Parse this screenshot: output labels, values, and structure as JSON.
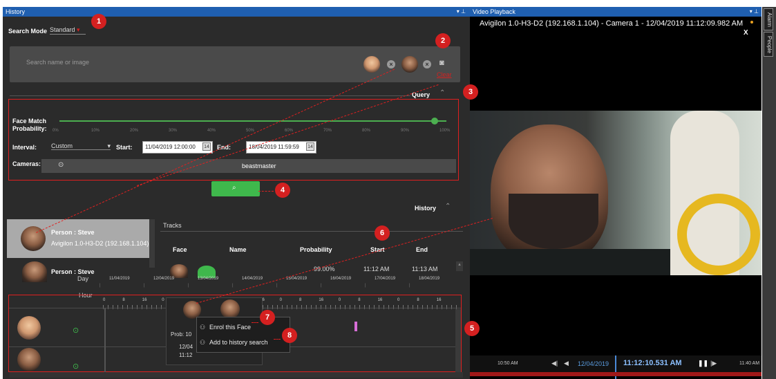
{
  "history_pane": {
    "title": "History",
    "search_mode_label": "Search Mode",
    "search_mode_value": "Standard",
    "search_placeholder": "Search name or image",
    "clear_label": "Clear",
    "query_header": "Query",
    "face_match_label": "Face Match Probability:",
    "probability_ticks": [
      "0%",
      "10%",
      "20%",
      "30%",
      "40%",
      "50%",
      "60%",
      "70%",
      "80%",
      "90%",
      "100%"
    ],
    "probability_value_fraction": 0.97,
    "interval_label": "Interval:",
    "interval_value": "Custom",
    "start_label": "Start:",
    "start_value": "11/04/2019 12:00:00",
    "end_label": "End:",
    "end_value": "18/04/2019 11:59:59",
    "cameras_label": "Cameras:",
    "camera_value": "beastmaster",
    "history_header": "History",
    "tracks_header": "Tracks",
    "results": [
      {
        "person": "Person : Steve",
        "camera": "Avigilon 1.0-H3-D2 (192.168.1.104) -"
      },
      {
        "person": "Person : Steve"
      }
    ],
    "table_headers": [
      "Face",
      "Name",
      "Probability",
      "Start",
      "End"
    ],
    "table_row": {
      "probability": "99.00%",
      "start": "11:12 AM",
      "end": "11:13 AM"
    },
    "timeline": {
      "day_label": "Day",
      "hour_label": "Hour",
      "days": [
        "11/04/2019",
        "12/04/2019",
        "13/04/2019",
        "14/04/2019",
        "15/04/2019",
        "16/04/2019",
        "17/04/2019",
        "18/04/2019"
      ],
      "hours": [
        "0",
        "8",
        "16",
        "0",
        "8",
        "16",
        "0",
        "8",
        "16",
        "0",
        "8",
        "16",
        "0",
        "8",
        "16",
        "0",
        "8",
        "16"
      ]
    },
    "popup": {
      "prob_text": "Prob: 10",
      "date_text": "12/04",
      "time_text": "11:12",
      "menu_items": [
        "Enrol this Face",
        "Add to history search"
      ]
    }
  },
  "video_pane": {
    "title": "Video Playback",
    "overlay_text": "Avigilon 1.0-H3-D2 (192.168.1.104) - Camera 1 - 12/04/2019 11:12:09.982 AM",
    "close_label": "X",
    "time_left": "10:50 AM",
    "date": "12/04/2019",
    "current_time": "11:12:10.531 AM",
    "time_right": "11:40 AM"
  },
  "side_tabs": [
    "Alarm",
    "People"
  ],
  "badges": [
    "1",
    "2",
    "3",
    "4",
    "5",
    "6",
    "7",
    "8"
  ],
  "colors": {
    "accent_blue": "#1f5fb0",
    "annotation_red": "#d42020",
    "search_green": "#3fb84c",
    "slider_green": "#4caf50"
  }
}
